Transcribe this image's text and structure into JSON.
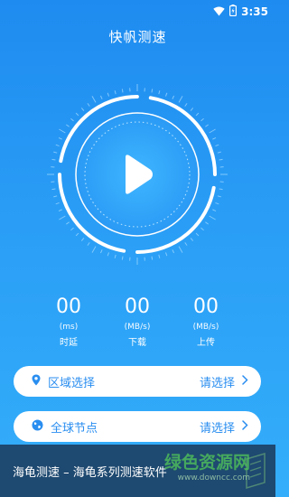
{
  "status_bar": {
    "time": "3:35"
  },
  "app_title": "快帆测速",
  "stats": [
    {
      "value": "00",
      "unit": "(ms)",
      "label": "时延"
    },
    {
      "value": "00",
      "unit": "(MB/s)",
      "label": "下载"
    },
    {
      "value": "00",
      "unit": "(MB/s)",
      "label": "上传"
    }
  ],
  "region_row": {
    "label": "区域选择",
    "value": "请选择"
  },
  "nodes_row": {
    "label": "全球节点",
    "value": "请选择"
  },
  "caption": "海龟测速 – 海龟系列测速软件",
  "watermark": {
    "text": "绿色资源网",
    "url": "www.downcc.com"
  },
  "colors": {
    "accent": "#2a8ef0",
    "background_top": "#1e8bf0",
    "background_bottom": "#34aefa"
  }
}
